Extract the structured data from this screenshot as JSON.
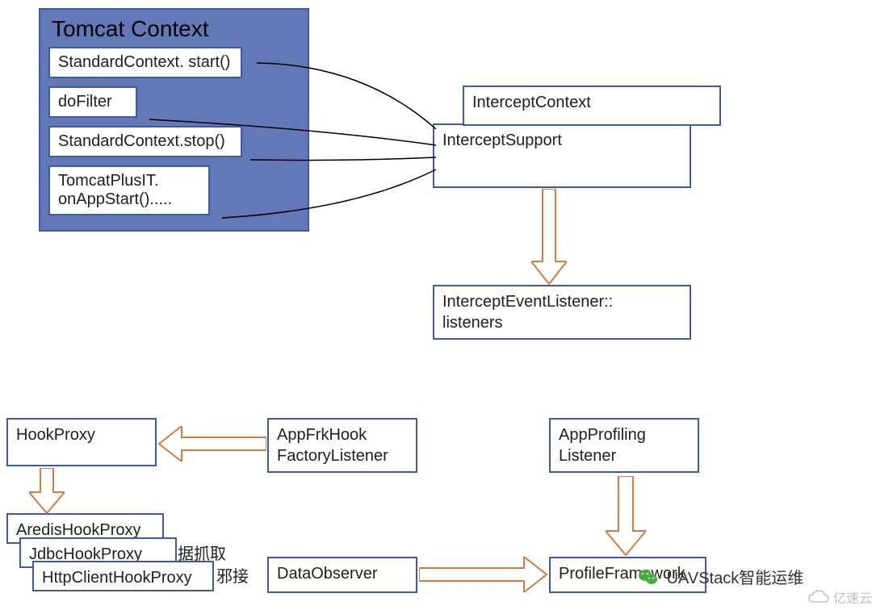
{
  "container": {
    "title": "Tomcat Context",
    "items": [
      "StandardContext. start()",
      "doFilter",
      "StandardContext.stop()",
      "TomcatPlusIT.\nonAppStart()....."
    ]
  },
  "boxes": {
    "interceptContext": "InterceptContext",
    "interceptSupport": "InterceptSupport",
    "interceptListener": "InterceptEventListener::\nlisteners",
    "hookProxy": "HookProxy",
    "appFrkHook": "AppFrkHook\nFactoryListener",
    "appProfiling": "AppProfiling\nListener",
    "aredisHookProxy": "AredisHookProxy",
    "jdbcHookProxy": "JdbcHookProxy",
    "httpClientHookProxy": "HttpClientHookProxy",
    "dataObserver": "DataObserver",
    "profileFramework": "ProfileFramework"
  },
  "annotations": {
    "text1": "据抓取",
    "text2": "邪接"
  },
  "watermark": {
    "uavstack": "UAVStack智能运维",
    "yisu": "亿速云"
  },
  "colors": {
    "border": "#3a5ba8",
    "containerBg": "#6379b7",
    "arrowFill": "#ffffff",
    "arrowStroke": "#d67a3e"
  }
}
